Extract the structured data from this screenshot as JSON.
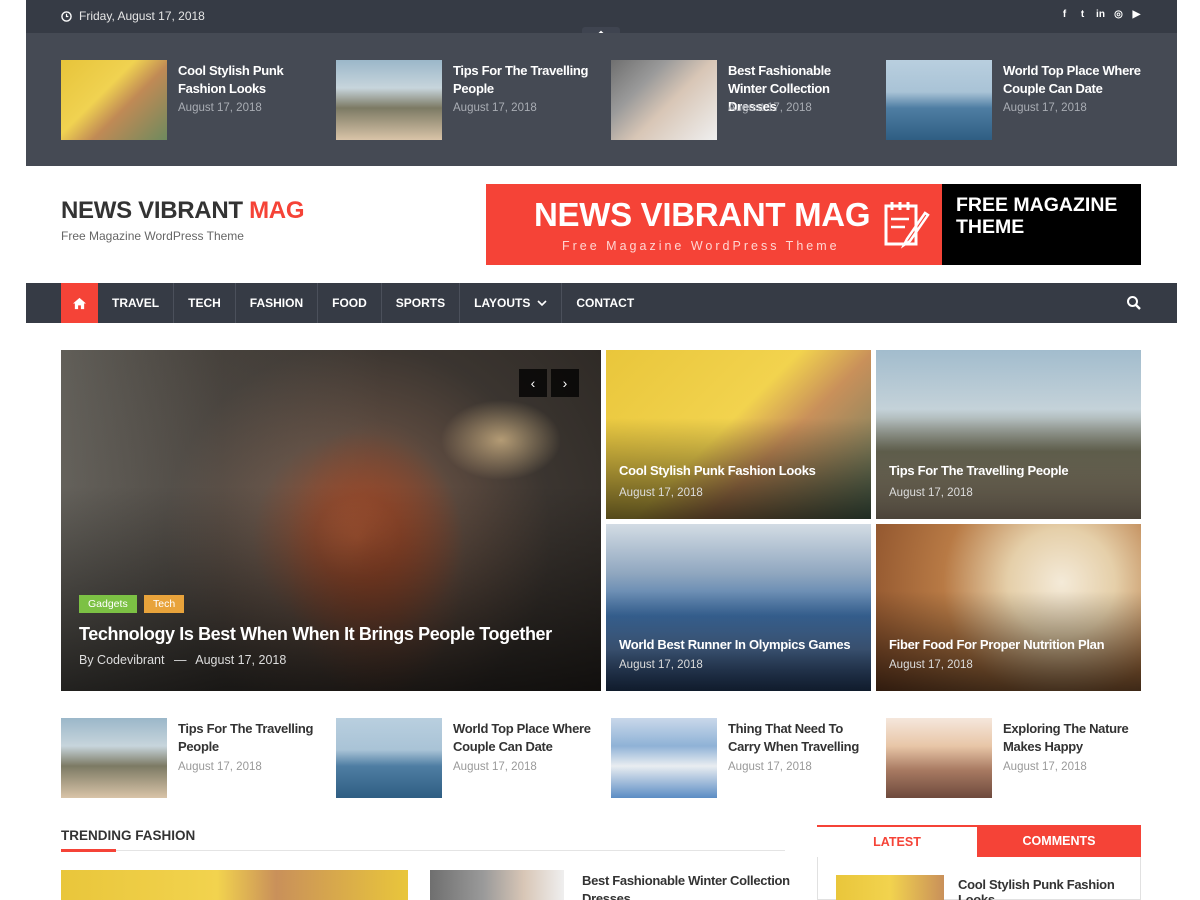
{
  "topbar": {
    "date": "Friday, August 17, 2018",
    "social_icons": [
      "facebook-icon",
      "twitter-icon",
      "linkedin-icon",
      "instagram-icon",
      "youtube-icon"
    ]
  },
  "ticker": [
    {
      "title": "Cool Stylish Punk Fashion Looks",
      "date": "August 17, 2018"
    },
    {
      "title": "Tips For The Travelling People",
      "date": "August 17, 2018"
    },
    {
      "title": "Best Fashionable Winter Collection Dresses",
      "date": "August 17, 2018"
    },
    {
      "title": "World Top Place Where Couple Can Date",
      "date": "August 17, 2018"
    }
  ],
  "header": {
    "logo_main": "NEWS VIBRANT ",
    "logo_accent": "MAG",
    "tagline": "Free Magazine WordPress Theme",
    "banner_title": "NEWS VIBRANT MAG",
    "banner_sub": "Free Magazine WordPress Theme",
    "banner_right": "FREE MAGAZINE THEME"
  },
  "nav": {
    "items": [
      "TRAVEL",
      "TECH",
      "FASHION",
      "FOOD",
      "SPORTS",
      "LAYOUTS",
      "CONTACT"
    ]
  },
  "hero": {
    "main": {
      "categories": [
        "Gadgets",
        "Tech"
      ],
      "title": "Technology Is Best When When It Brings People Together",
      "author": "By Codevibrant",
      "separator": "—",
      "date": "August 17, 2018"
    },
    "tiles": [
      {
        "title": "Cool Stylish Punk Fashion Looks",
        "date": "August 17, 2018"
      },
      {
        "title": "Tips For The Travelling People",
        "date": "August 17, 2018"
      },
      {
        "title": "World Best Runner In Olympics Games",
        "date": "August 17, 2018"
      },
      {
        "title": "Fiber Food For Proper Nutrition Plan",
        "date": "August 17, 2018"
      }
    ]
  },
  "row_posts": [
    {
      "title": "Tips For The Travelling People",
      "date": "August 17, 2018"
    },
    {
      "title": "World Top Place Where Couple Can Date",
      "date": "August 17, 2018"
    },
    {
      "title": "Thing That Need To Carry When Travelling",
      "date": "August 17, 2018"
    },
    {
      "title": "Exploring The Nature Makes Happy",
      "date": "August 17, 2018"
    }
  ],
  "trending": {
    "heading": "TRENDING FASHION",
    "second_title": "Best Fashionable Winter Collection Dresses"
  },
  "sidebar": {
    "tabs": [
      "LATEST",
      "COMMENTS"
    ],
    "first_title": "Cool Stylish Punk Fashion Looks"
  },
  "colors": {
    "accent": "#f54337",
    "dark": "#363b45",
    "ticker_bg": "#454a54"
  }
}
